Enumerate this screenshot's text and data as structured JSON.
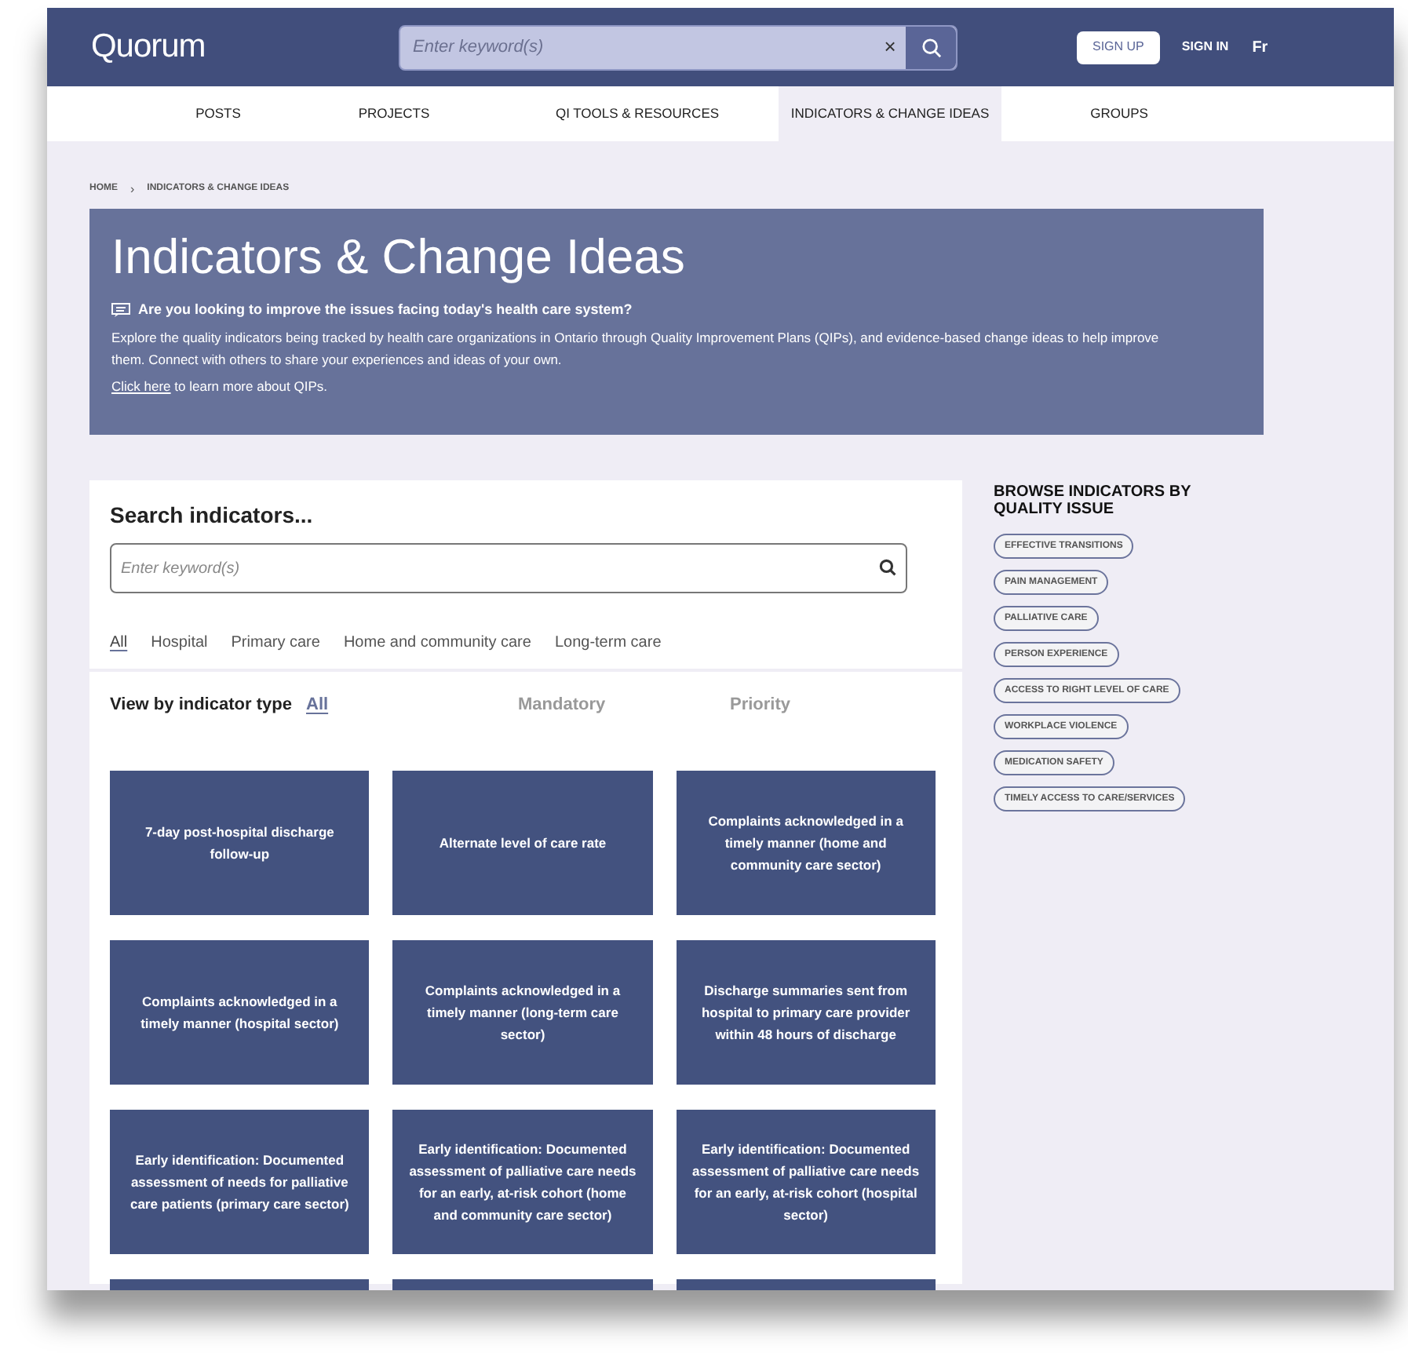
{
  "header": {
    "logo": "Quorum",
    "search": {
      "placeholder": "Enter keyword(s)",
      "clear": "×"
    },
    "sign_up": "SIGN UP",
    "sign_in": "SIGN IN",
    "language": "Fr"
  },
  "nav": [
    {
      "label": "POSTS",
      "selected": false
    },
    {
      "label": "PROJECTS",
      "selected": false
    },
    {
      "label": "QI TOOLS & RESOURCES",
      "selected": false
    },
    {
      "label": "INDICATORS & CHANGE IDEAS",
      "selected": true
    },
    {
      "label": "GROUPS",
      "selected": false
    }
  ],
  "breadcrumb": [
    "HOME",
    "INDICATORS & CHANGE IDEAS"
  ],
  "breadcrumb_separator": "›",
  "hero": {
    "title": "Indicators & Change Ideas",
    "question": "Are you looking to improve the issues facing today's health care system?",
    "text": "Explore the quality indicators being tracked by health care organizations in Ontario through Quality Improvement Plans (QIPs), and evidence-based change ideas to help improve them. Connect with others to share your experiences and ideas of your own.",
    "link": "Click here",
    "link_suffix": " to learn more about QIPs."
  },
  "search_panel": {
    "title": "Search indicators...",
    "placeholder": "Enter keyword(s)",
    "sectors": [
      {
        "label": "All",
        "selected": true
      },
      {
        "label": "Hospital",
        "selected": false
      },
      {
        "label": "Primary care",
        "selected": false
      },
      {
        "label": "Home and community care",
        "selected": false
      },
      {
        "label": "Long-term care",
        "selected": false
      }
    ]
  },
  "type_filter": {
    "label": "View by indicator type",
    "options": [
      {
        "label": "All",
        "selected": true
      },
      {
        "label": "Mandatory",
        "selected": false
      },
      {
        "label": "Priority",
        "selected": false
      }
    ]
  },
  "indicators": [
    {
      "kind": "tile",
      "title": "7-day post-hospital discharge follow-up"
    },
    {
      "kind": "tile",
      "title": "Alternate level of care rate"
    },
    {
      "kind": "tile",
      "title": "Complaints acknowledged in a timely manner (home and community care sector)"
    },
    {
      "kind": "tile",
      "title": "Complaints acknowledged in a timely manner (hospital sector)"
    },
    {
      "kind": "tile",
      "title": "Complaints acknowledged in a timely manner (long-term care sector)"
    },
    {
      "kind": "tile",
      "title": "Discharge summaries sent from hospital to primary care provider within 48 hours of discharge"
    },
    {
      "kind": "tile",
      "title": "Early identification: Documented assessment of needs for palliative care patients (primary care sector)"
    },
    {
      "kind": "tile",
      "title": "Early identification: Documented assessment of palliative care needs for an early, at-risk cohort (home and community care sector)"
    },
    {
      "kind": "tile",
      "title": "Early identification: Documented assessment of palliative care needs for an early, at-risk cohort (hospital sector)"
    },
    {
      "kind": "cut"
    },
    {
      "kind": "cut"
    },
    {
      "kind": "cut"
    }
  ],
  "browse": {
    "title": "BROWSE INDICATORS BY QUALITY ISSUE",
    "tags": [
      "EFFECTIVE TRANSITIONS",
      "PAIN MANAGEMENT",
      "PALLIATIVE CARE",
      "PERSON EXPERIENCE",
      "ACCESS TO RIGHT LEVEL OF CARE",
      "WORKPLACE VIOLENCE",
      "MEDICATION SAFETY",
      "TIMELY ACCESS TO CARE/SERVICES"
    ]
  }
}
